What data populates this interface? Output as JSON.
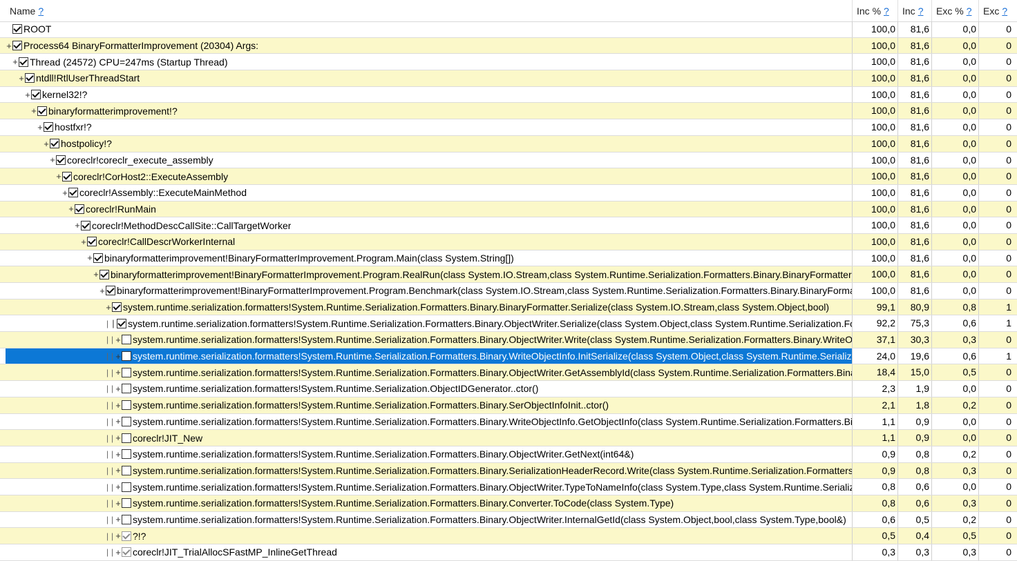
{
  "header": {
    "name_label": "Name",
    "inc_pct_label": "Inc %",
    "inc_label": "Inc",
    "exc_pct_label": "Exc %",
    "exc_label": "Exc",
    "help_glyph": "?"
  },
  "rows": [
    {
      "depth": 0,
      "guides": 0,
      "expander": "",
      "check": "checked",
      "label": "ROOT",
      "inc_pct": "100,0",
      "inc": "81,6",
      "exc_pct": "0,0",
      "exc": "0",
      "selected": false
    },
    {
      "depth": 0,
      "guides": 0,
      "expander": "+",
      "check": "checked",
      "label": "Process64 BinaryFormatterImprovement (20304) Args:",
      "inc_pct": "100,0",
      "inc": "81,6",
      "exc_pct": "0,0",
      "exc": "0",
      "selected": false
    },
    {
      "depth": 1,
      "guides": 0,
      "expander": "+",
      "check": "checked",
      "label": "Thread (24572) CPU=247ms (Startup Thread)",
      "inc_pct": "100,0",
      "inc": "81,6",
      "exc_pct": "0,0",
      "exc": "0",
      "selected": false
    },
    {
      "depth": 2,
      "guides": 0,
      "expander": "+",
      "check": "checked",
      "label": "ntdll!RtlUserThreadStart",
      "inc_pct": "100,0",
      "inc": "81,6",
      "exc_pct": "0,0",
      "exc": "0",
      "selected": false
    },
    {
      "depth": 3,
      "guides": 0,
      "expander": "+",
      "check": "checked",
      "label": "kernel32!?",
      "inc_pct": "100,0",
      "inc": "81,6",
      "exc_pct": "0,0",
      "exc": "0",
      "selected": false
    },
    {
      "depth": 4,
      "guides": 0,
      "expander": "+",
      "check": "checked",
      "label": "binaryformatterimprovement!?",
      "inc_pct": "100,0",
      "inc": "81,6",
      "exc_pct": "0,0",
      "exc": "0",
      "selected": false
    },
    {
      "depth": 5,
      "guides": 0,
      "expander": "+",
      "check": "checked",
      "label": "hostfxr!?",
      "inc_pct": "100,0",
      "inc": "81,6",
      "exc_pct": "0,0",
      "exc": "0",
      "selected": false
    },
    {
      "depth": 6,
      "guides": 0,
      "expander": "+",
      "check": "checked",
      "label": "hostpolicy!?",
      "inc_pct": "100,0",
      "inc": "81,6",
      "exc_pct": "0,0",
      "exc": "0",
      "selected": false
    },
    {
      "depth": 7,
      "guides": 0,
      "expander": "+",
      "check": "checked",
      "label": "coreclr!coreclr_execute_assembly",
      "inc_pct": "100,0",
      "inc": "81,6",
      "exc_pct": "0,0",
      "exc": "0",
      "selected": false
    },
    {
      "depth": 8,
      "guides": 0,
      "expander": "+",
      "check": "checked",
      "label": "coreclr!CorHost2::ExecuteAssembly",
      "inc_pct": "100,0",
      "inc": "81,6",
      "exc_pct": "0,0",
      "exc": "0",
      "selected": false
    },
    {
      "depth": 9,
      "guides": 0,
      "expander": "+",
      "check": "checked",
      "label": "coreclr!Assembly::ExecuteMainMethod",
      "inc_pct": "100,0",
      "inc": "81,6",
      "exc_pct": "0,0",
      "exc": "0",
      "selected": false
    },
    {
      "depth": 10,
      "guides": 0,
      "expander": "+",
      "check": "checked",
      "label": "coreclr!RunMain",
      "inc_pct": "100,0",
      "inc": "81,6",
      "exc_pct": "0,0",
      "exc": "0",
      "selected": false
    },
    {
      "depth": 11,
      "guides": 0,
      "expander": "+",
      "check": "checked",
      "label": "coreclr!MethodDescCallSite::CallTargetWorker",
      "inc_pct": "100,0",
      "inc": "81,6",
      "exc_pct": "0,0",
      "exc": "0",
      "selected": false
    },
    {
      "depth": 12,
      "guides": 0,
      "expander": "+",
      "check": "checked",
      "label": "coreclr!CallDescrWorkerInternal",
      "inc_pct": "100,0",
      "inc": "81,6",
      "exc_pct": "0,0",
      "exc": "0",
      "selected": false
    },
    {
      "depth": 13,
      "guides": 0,
      "expander": "+",
      "check": "checked",
      "label": "binaryformatterimprovement!BinaryFormatterImprovement.Program.Main(class System.String[])",
      "inc_pct": "100,0",
      "inc": "81,6",
      "exc_pct": "0,0",
      "exc": "0",
      "selected": false
    },
    {
      "depth": 14,
      "guides": 0,
      "expander": "+",
      "check": "checked",
      "label": "binaryformatterimprovement!BinaryFormatterImprovement.Program.RealRun(class System.IO.Stream,class System.Runtime.Serialization.Formatters.Binary.BinaryFormatter)",
      "inc_pct": "100,0",
      "inc": "81,6",
      "exc_pct": "0,0",
      "exc": "0",
      "selected": false
    },
    {
      "depth": 15,
      "guides": 0,
      "expander": "+",
      "check": "checked",
      "label": "binaryformatterimprovement!BinaryFormatterImprovement.Program.Benchmark(class System.IO.Stream,class System.Runtime.Serialization.Formatters.Binary.BinaryFormatter)",
      "inc_pct": "100,0",
      "inc": "81,6",
      "exc_pct": "0,0",
      "exc": "0",
      "selected": false
    },
    {
      "depth": 16,
      "guides": 0,
      "expander": "+",
      "check": "checked",
      "label": "system.runtime.serialization.formatters!System.Runtime.Serialization.Formatters.Binary.BinaryFormatter.Serialize(class System.IO.Stream,class System.Object,bool)",
      "inc_pct": "99,1",
      "inc": "80,9",
      "exc_pct": "0,8",
      "exc": "1",
      "selected": false
    },
    {
      "depth": 16,
      "guides": 1,
      "expander": "|",
      "check": "checked",
      "label": "system.runtime.serialization.formatters!System.Runtime.Serialization.Formatters.Binary.ObjectWriter.Serialize(class System.Object,class System.Runtime.Serialization.Formatters.Binary.BinaryFormatter)",
      "inc_pct": "92,2",
      "inc": "75,3",
      "exc_pct": "0,6",
      "exc": "1",
      "selected": false
    },
    {
      "depth": 16,
      "guides": 2,
      "expander": "+",
      "check": "none",
      "label": "system.runtime.serialization.formatters!System.Runtime.Serialization.Formatters.Binary.ObjectWriter.Write(class System.Runtime.Serialization.Formatters.Binary.WriteObjectInfo)",
      "inc_pct": "37,1",
      "inc": "30,3",
      "exc_pct": "0,3",
      "exc": "0",
      "selected": false
    },
    {
      "depth": 16,
      "guides": 2,
      "expander": "+",
      "check": "none",
      "label": "system.runtime.serialization.formatters!System.Runtime.Serialization.Formatters.Binary.WriteObjectInfo.InitSerialize(class System.Object,class System.Runtime.Serialization.Formatters.Binary.ObjectWriter)",
      "inc_pct": "24,0",
      "inc": "19,6",
      "exc_pct": "0,6",
      "exc": "1",
      "selected": true
    },
    {
      "depth": 16,
      "guides": 2,
      "expander": "+",
      "check": "none",
      "label": "system.runtime.serialization.formatters!System.Runtime.Serialization.Formatters.Binary.ObjectWriter.GetAssemblyId(class System.Runtime.Serialization.Formatters.Binary.WriteObjectInfo)",
      "inc_pct": "18,4",
      "inc": "15,0",
      "exc_pct": "0,5",
      "exc": "0",
      "selected": false
    },
    {
      "depth": 16,
      "guides": 2,
      "expander": "+",
      "check": "none",
      "label": "system.runtime.serialization.formatters!System.Runtime.Serialization.ObjectIDGenerator..ctor()",
      "inc_pct": "2,3",
      "inc": "1,9",
      "exc_pct": "0,0",
      "exc": "0",
      "selected": false
    },
    {
      "depth": 16,
      "guides": 2,
      "expander": "+",
      "check": "none",
      "label": "system.runtime.serialization.formatters!System.Runtime.Serialization.Formatters.Binary.SerObjectInfoInit..ctor()",
      "inc_pct": "2,1",
      "inc": "1,8",
      "exc_pct": "0,2",
      "exc": "0",
      "selected": false
    },
    {
      "depth": 16,
      "guides": 2,
      "expander": "+",
      "check": "none",
      "label": "system.runtime.serialization.formatters!System.Runtime.Serialization.Formatters.Binary.WriteObjectInfo.GetObjectInfo(class System.Runtime.Serialization.Formatters.Binary.SerObjectInfoInit)",
      "inc_pct": "1,1",
      "inc": "0,9",
      "exc_pct": "0,0",
      "exc": "0",
      "selected": false
    },
    {
      "depth": 16,
      "guides": 2,
      "expander": "+",
      "check": "none",
      "label": "coreclr!JIT_New",
      "inc_pct": "1,1",
      "inc": "0,9",
      "exc_pct": "0,0",
      "exc": "0",
      "selected": false
    },
    {
      "depth": 16,
      "guides": 2,
      "expander": "+",
      "check": "none",
      "label": "system.runtime.serialization.formatters!System.Runtime.Serialization.Formatters.Binary.ObjectWriter.GetNext(int64&)",
      "inc_pct": "0,9",
      "inc": "0,8",
      "exc_pct": "0,2",
      "exc": "0",
      "selected": false
    },
    {
      "depth": 16,
      "guides": 2,
      "expander": "+",
      "check": "none",
      "label": "system.runtime.serialization.formatters!System.Runtime.Serialization.Formatters.Binary.SerializationHeaderRecord.Write(class System.Runtime.Serialization.Formatters.Binary.BinaryFormatterWriter)",
      "inc_pct": "0,9",
      "inc": "0,8",
      "exc_pct": "0,3",
      "exc": "0",
      "selected": false
    },
    {
      "depth": 16,
      "guides": 2,
      "expander": "+",
      "check": "none",
      "label": "system.runtime.serialization.formatters!System.Runtime.Serialization.Formatters.Binary.ObjectWriter.TypeToNameInfo(class System.Type,class System.Runtime.Serialization.Formatters.Binary.NameInfo)",
      "inc_pct": "0,8",
      "inc": "0,6",
      "exc_pct": "0,0",
      "exc": "0",
      "selected": false
    },
    {
      "depth": 16,
      "guides": 2,
      "expander": "+",
      "check": "none",
      "label": "system.runtime.serialization.formatters!System.Runtime.Serialization.Formatters.Binary.Converter.ToCode(class System.Type)",
      "inc_pct": "0,8",
      "inc": "0,6",
      "exc_pct": "0,3",
      "exc": "0",
      "selected": false
    },
    {
      "depth": 16,
      "guides": 2,
      "expander": "+",
      "check": "none",
      "label": "system.runtime.serialization.formatters!System.Runtime.Serialization.Formatters.Binary.ObjectWriter.InternalGetId(class System.Object,bool,class System.Type,bool&)",
      "inc_pct": "0,6",
      "inc": "0,5",
      "exc_pct": "0,2",
      "exc": "0",
      "selected": false
    },
    {
      "depth": 16,
      "guides": 2,
      "expander": "+",
      "check": "dim",
      "label": "?!?",
      "inc_pct": "0,5",
      "inc": "0,4",
      "exc_pct": "0,5",
      "exc": "0",
      "selected": false
    },
    {
      "depth": 16,
      "guides": 2,
      "expander": "+",
      "check": "dim",
      "label": "coreclr!JIT_TrialAllocSFastMP_InlineGetThread",
      "inc_pct": "0,3",
      "inc": "0,3",
      "exc_pct": "0,3",
      "exc": "0",
      "selected": false
    }
  ]
}
